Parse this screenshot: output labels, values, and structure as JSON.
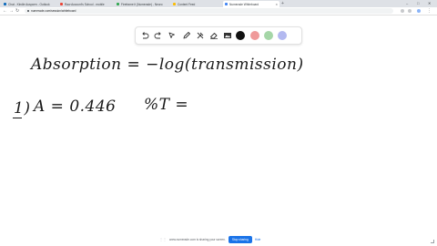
{
  "browser": {
    "tabs": [
      {
        "label": "Chat - Kindle Auspoen - Outlook",
        "fav": "#0f6cbd",
        "active": false
      },
      {
        "label": "Raw Account's School - mobile",
        "fav": "#ea4335",
        "active": false
      },
      {
        "label": "Fireframe it (Numerade) - Neuro",
        "fav": "#34a853",
        "active": false
      },
      {
        "label": "Content Feed",
        "fav": "#fbbc04",
        "active": false
      },
      {
        "label": "Numerade Whiteboard",
        "fav": "#4285f4",
        "active": true
      }
    ],
    "new_tab": "+",
    "url": "numerade.com/session/whiteboard",
    "window_controls": {
      "minimize": "–",
      "maximize": "□",
      "close": "✕"
    }
  },
  "toolbar": {
    "tools": [
      {
        "name": "undo-icon"
      },
      {
        "name": "redo-icon"
      },
      {
        "name": "pointer-icon"
      },
      {
        "name": "pen-icon"
      },
      {
        "name": "tools-icon"
      },
      {
        "name": "eraser-icon"
      },
      {
        "name": "image-icon"
      }
    ],
    "colors": [
      "#111111",
      "#ef9a9a",
      "#a5d6a7",
      "#b3b9f0"
    ]
  },
  "board": {
    "line1": "Absorption = −log(transmission)",
    "line2_label": "1)",
    "line2_eq": "A =  0.446",
    "line2_pct": "%T ="
  },
  "share": {
    "text": "www.numerade.com is sharing your screen.",
    "stop": "Stop sharing",
    "hide": "Hide",
    "grip": "⋮⋮"
  }
}
